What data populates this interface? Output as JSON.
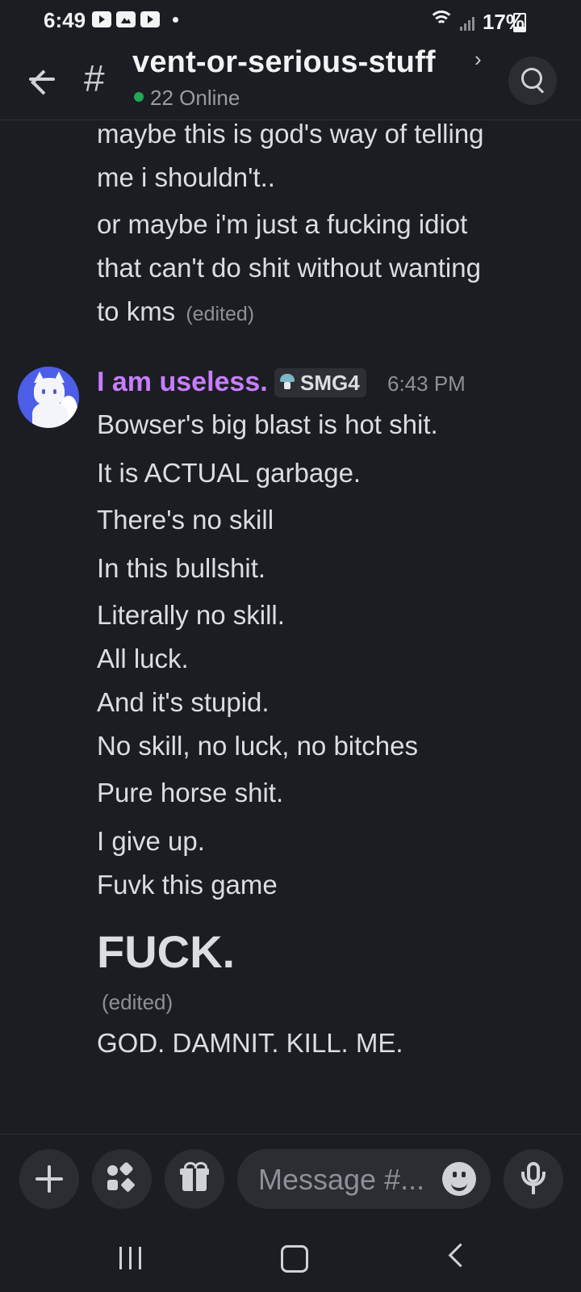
{
  "status_bar": {
    "time": "6:49",
    "battery": "17%",
    "icons": [
      "youtube-icon",
      "gallery-icon",
      "youtube-icon",
      "dot-icon",
      "wifi-icon",
      "signal-icon",
      "battery-icon"
    ]
  },
  "header": {
    "channel_name": "vent-or-serious-stuff",
    "online": "22 Online",
    "online_color": "#23a55a"
  },
  "messages": {
    "prev_lines": [
      "maybe this is god's way of telling",
      "me i shouldn't..",
      "or maybe i'm just a fucking idiot",
      "that can't do shit without wanting",
      "to kms"
    ],
    "prev_edited": "(edited)",
    "author": {
      "name": "I am useless.",
      "name_color": "#c77dff",
      "role": "SMG4",
      "time": "6:43 PM"
    },
    "lines": [
      "Bowser's big blast is hot shit.",
      "It is ACTUAL garbage.",
      "There's no skill",
      "In this bullshit.",
      "Literally no skill.",
      "All luck.",
      "And it's stupid.",
      "No skill, no luck, no bitches",
      "Pure horse shit.",
      "I give up.",
      "Fuvk this game"
    ],
    "big_line": "FUCK.",
    "big_edited": "(edited)",
    "last_line": "GOD. DAMNIT. KILL. ME."
  },
  "composer": {
    "placeholder": "Message #..."
  }
}
